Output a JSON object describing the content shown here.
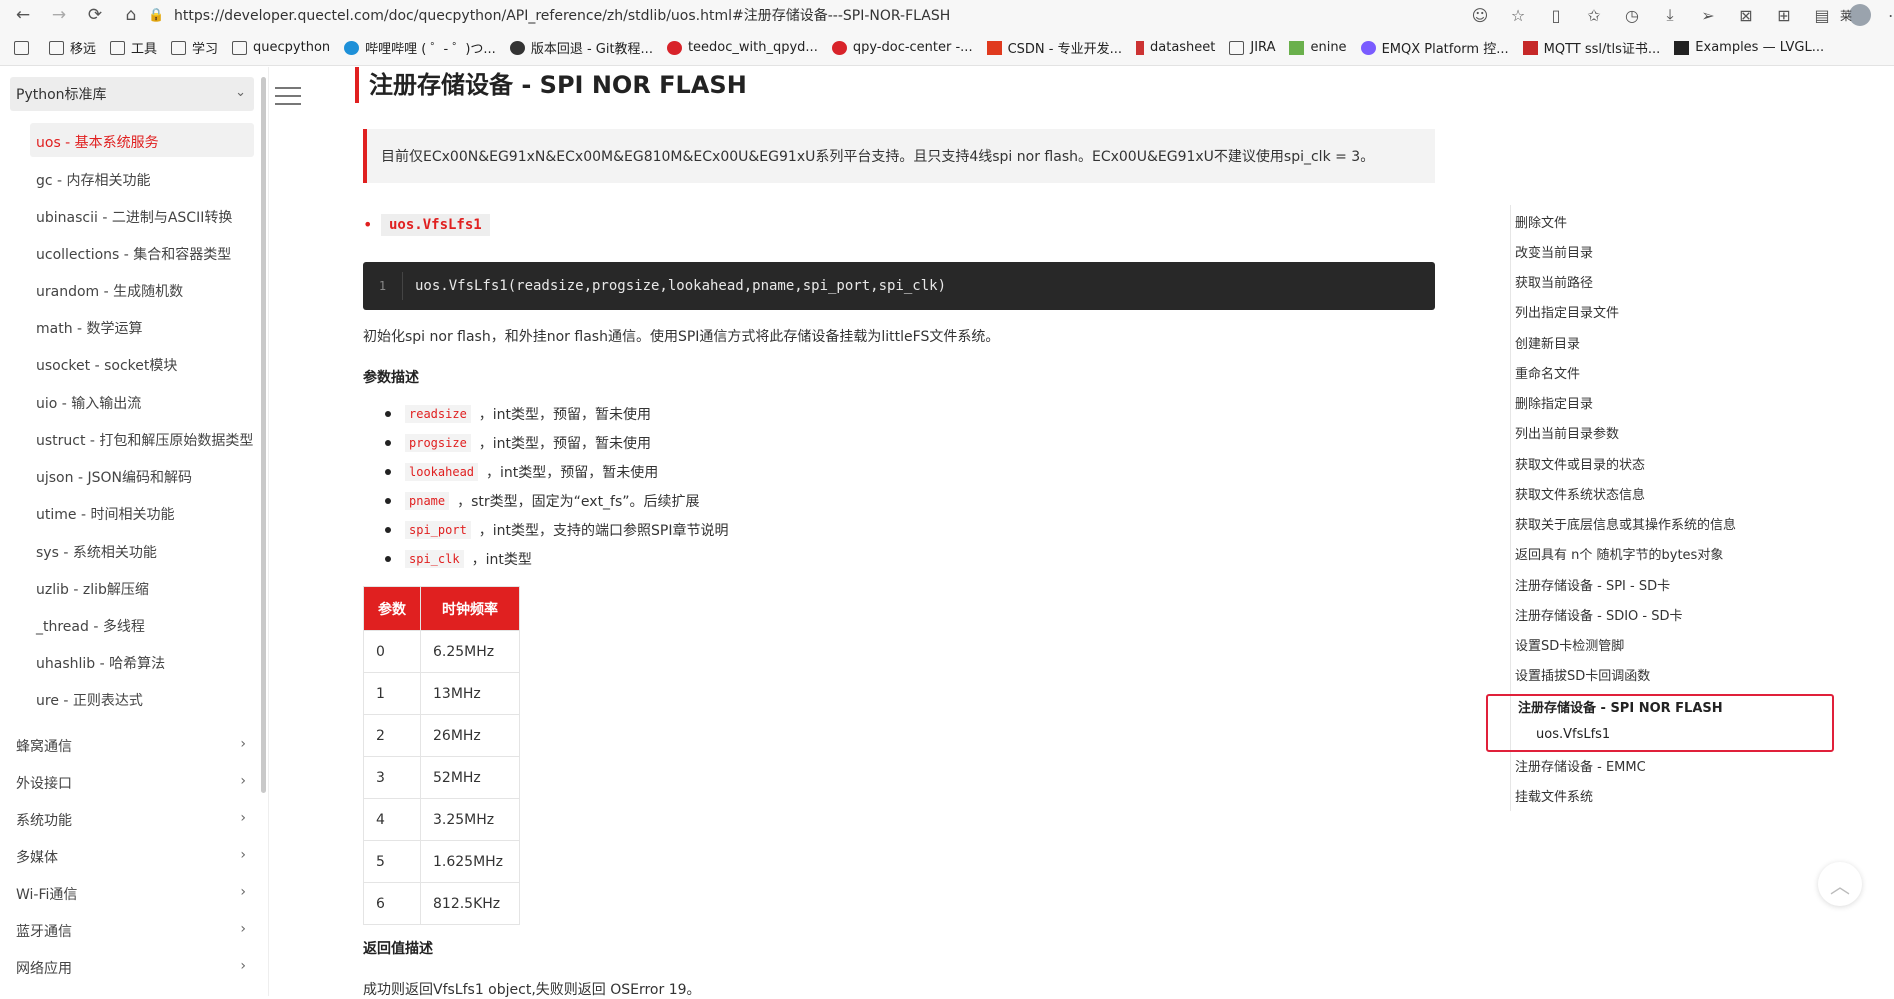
{
  "browser": {
    "url": "https://developer.quectel.com/doc/quecpython/API_reference/zh/stdlib/uos.html#注册存储设备---SPI-NOR-FLASH",
    "right_text": "莱",
    "bookmarks": [
      "移远",
      "工具",
      "学习",
      "quecpython",
      "哔哩哔哩 ( ゜- ゜)つ...",
      "版本回退 - Git教程...",
      "teedoc_with_qpyd...",
      "qpy-doc-center -...",
      "CSDN - 专业开发...",
      "datasheet",
      "JIRA",
      "enine",
      "EMQX Platform 控...",
      "MQTT ssl/tls证书...",
      "Examples — LVGL..."
    ]
  },
  "sidebar": {
    "section_title": "Python标准库",
    "items": [
      "uos - 基本系统服务",
      "gc - 内存相关功能",
      "ubinascii - 二进制与ASCII转换",
      "ucollections - 集合和容器类型",
      "urandom - 生成随机数",
      "math - 数学运算",
      "usocket - socket模块",
      "uio - 输入输出流",
      "ustruct - 打包和解压原始数据类型",
      "ujson - JSON编码和解码",
      "utime - 时间相关功能",
      "sys - 系统相关功能",
      "uzlib - zlib解压缩",
      "_thread - 多线程",
      "uhashlib - 哈希算法",
      "ure - 正则表达式"
    ],
    "categories": [
      "蜂窝通信",
      "外设接口",
      "系统功能",
      "多媒体",
      "Wi-Fi通信",
      "蓝牙通信",
      "网络应用"
    ]
  },
  "content": {
    "title": "注册存储设备 - SPI NOR FLASH",
    "note": "目前仅ECx00N&EG91xN&ECx00M&EG810M&ECx00U&EG91xU系列平台支持。且只支持4线spi nor flash。ECx00U&EG91xU不建议使用spi_clk = 3。",
    "function_name": "uos.VfsLfs1",
    "code_line_number": "1",
    "code": "uos.VfsLfs1(readsize,progsize,lookahead,pname,spi_port,spi_clk)",
    "description": "初始化spi nor flash，和外挂nor flash通信。使用SPI通信方式将此存储设备挂载为littleFS文件系统。",
    "params_heading": "参数描述",
    "params": [
      {
        "name": "readsize",
        "desc": "，int类型，预留，暂未使用"
      },
      {
        "name": "progsize",
        "desc": "，int类型，预留，暂未使用"
      },
      {
        "name": "lookahead",
        "desc": "，int类型，预留，暂未使用"
      },
      {
        "name": "pname",
        "desc": "，str类型，固定为“ext_fs”。后续扩展"
      },
      {
        "name": "spi_port",
        "desc": "，int类型，支持的端口参照SPI章节说明"
      },
      {
        "name": "spi_clk",
        "desc": "，int类型"
      }
    ],
    "table": {
      "headers": [
        "参数",
        "时钟频率"
      ],
      "rows": [
        [
          "0",
          "6.25MHz"
        ],
        [
          "1",
          "13MHz"
        ],
        [
          "2",
          "26MHz"
        ],
        [
          "3",
          "52MHz"
        ],
        [
          "4",
          "3.25MHz"
        ],
        [
          "5",
          "1.625MHz"
        ],
        [
          "6",
          "812.5KHz"
        ]
      ]
    },
    "return_heading": "返回值描述",
    "return_text": "成功则返回VfsLfs1 object,失败则返回 OSError 19。"
  },
  "toc": {
    "items": [
      "删除文件",
      "改变当前目录",
      "获取当前路径",
      "列出指定目录文件",
      "创建新目录",
      "重命名文件",
      "删除指定目录",
      "列出当前目录参数",
      "获取文件或目录的状态",
      "获取文件系统状态信息",
      "获取关于底层信息或其操作系统的信息",
      "返回具有 n个 随机字节的bytes对象",
      "注册存储设备 - SPI - SD卡",
      "注册存储设备 - SDIO - SD卡",
      "设置SD卡检测管脚",
      "设置插拔SD卡回调函数"
    ],
    "current": "注册存储设备 - SPI NOR FLASH",
    "current_sub": "uos.VfsLfs1",
    "after": [
      "注册存储设备 - EMMC",
      "挂载文件系统"
    ]
  },
  "colors": {
    "accent": "#e02020",
    "highlight_box": "#e0203a"
  }
}
